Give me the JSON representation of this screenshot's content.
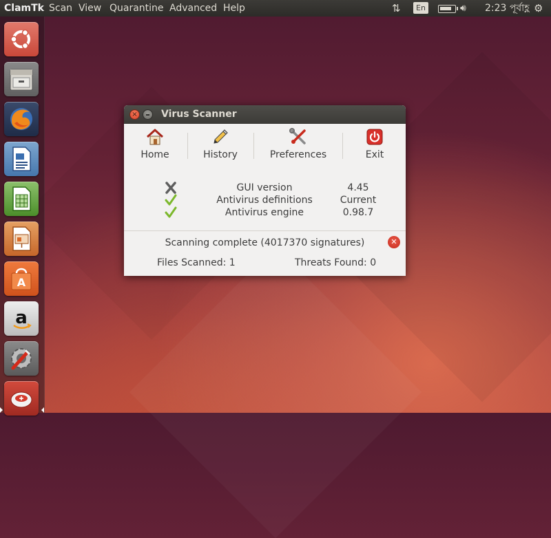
{
  "top_panel": {
    "app_name": "ClamTk",
    "menus": [
      "Scan",
      "View",
      "Quarantine",
      "Advanced",
      "Help"
    ],
    "keyboard_layout": "En",
    "clock": "2:23 পূর্বাহ্ণ",
    "icons": {
      "network": "network-updown-icon",
      "battery": "battery-icon",
      "volume": "volume-icon",
      "session": "gear-icon"
    }
  },
  "launcher": {
    "items": [
      {
        "name": "ubuntu-dash-icon"
      },
      {
        "name": "files-icon"
      },
      {
        "name": "firefox-icon"
      },
      {
        "name": "libreoffice-writer-icon"
      },
      {
        "name": "libreoffice-calc-icon"
      },
      {
        "name": "libreoffice-impress-icon"
      },
      {
        "name": "software-center-icon"
      },
      {
        "name": "amazon-icon"
      },
      {
        "name": "system-settings-icon"
      },
      {
        "name": "clamtk-icon"
      }
    ],
    "active_item": "clamtk-icon"
  },
  "window": {
    "title": "Virus Scanner",
    "toolbar": {
      "home": "Home",
      "history": "History",
      "preferences": "Preferences",
      "exit": "Exit"
    },
    "status": [
      {
        "icon": "x-icon",
        "label": "GUI version",
        "value": "4.45"
      },
      {
        "icon": "checkmark-icon",
        "label": "Antivirus definitions",
        "value": "Current"
      },
      {
        "icon": "checkmark-icon",
        "label": "Antivirus engine",
        "value": "0.98.7"
      }
    ],
    "scan_status": "Scanning complete (4017370 signatures)",
    "files_scanned": "Files Scanned: 1",
    "threats_found": "Threats Found: 0"
  },
  "colors": {
    "panel": "#3c3b37",
    "window_bg": "#f2f1f0",
    "close_red": "#d8422b",
    "check_green": "#6aa022"
  }
}
